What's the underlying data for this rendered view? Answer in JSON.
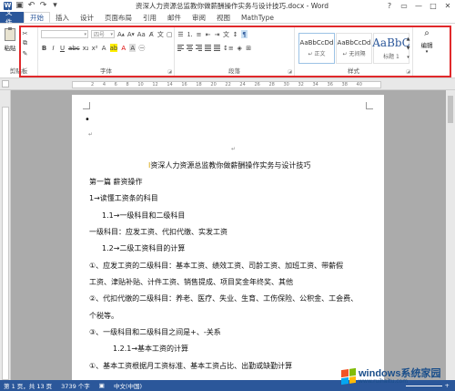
{
  "window": {
    "title": "资深人力资源总监教你做薪酬操作实务与设计技巧.docx - Word",
    "controls": [
      "?",
      "▭",
      "—",
      "□",
      "✕"
    ]
  },
  "tabs": [
    {
      "label": "文件"
    },
    {
      "label": "开始"
    },
    {
      "label": "插入"
    },
    {
      "label": "设计"
    },
    {
      "label": "页面布局"
    },
    {
      "label": "引用"
    },
    {
      "label": "邮件"
    },
    {
      "label": "审阅"
    },
    {
      "label": "视图"
    },
    {
      "label": "MathType"
    }
  ],
  "ribbon": {
    "clipboard": {
      "paste_label": "粘贴",
      "group_label": "剪贴板"
    },
    "font": {
      "font_name": "",
      "font_size": "四号",
      "group_label": "字体"
    },
    "paragraph": {
      "group_label": "段落"
    },
    "styles": {
      "items": [
        {
          "sample": "AaBbCcDd",
          "name": "↵ 正文"
        },
        {
          "sample": "AaBbCcDd",
          "name": "↵ 无间隔"
        },
        {
          "sample": "AaBbC",
          "name": "标题 1"
        }
      ],
      "group_label": "样式"
    },
    "editing": {
      "label": "编辑"
    }
  },
  "ruler": {
    "marks": [
      "2",
      "4",
      "6",
      "8",
      "10",
      "12",
      "14",
      "16",
      "18",
      "20",
      "22",
      "24",
      "26",
      "28",
      "30",
      "32",
      "34",
      "36",
      "38",
      "40"
    ]
  },
  "document": {
    "lines": [
      "资深人力资源总监教你做薪酬操作实务与设计技巧",
      "第一篇  薪资操作",
      "1→读懂工资条的科目",
      "1.1→一级科目和二级科目",
      "一级科目：应发工资、代扣代缴、实发工资",
      "1.2→二级工资科目的计算",
      "①、应发工资的二级科目：基本工资、绩效工资、司龄工资、加班工资、带薪假",
      "工资、津贴补贴、计件工资、销售提成、项目奖金年终奖、其他",
      "②、代扣代缴的二级科目：养老、医疗、失业、生育、工伤保险、公积金、工会费、",
      "个税等。",
      "③、一级科目和二级科目之间是+、-关系",
      "1.2.1→基本工资的计算",
      "①、基本工资根据月工资标准、基本工资占比、出勤或缺勤计算"
    ]
  },
  "statusbar": {
    "page": "第 1 页，共 13 页",
    "words": "3739 个字",
    "language": "中文(中国)",
    "zoom": "+"
  },
  "watermark": {
    "main": "windows系统家园",
    "sub": "www.ruihaitu.com",
    "colors": [
      "#f35325",
      "#81bc06",
      "#05a6f0",
      "#ffba08"
    ]
  }
}
